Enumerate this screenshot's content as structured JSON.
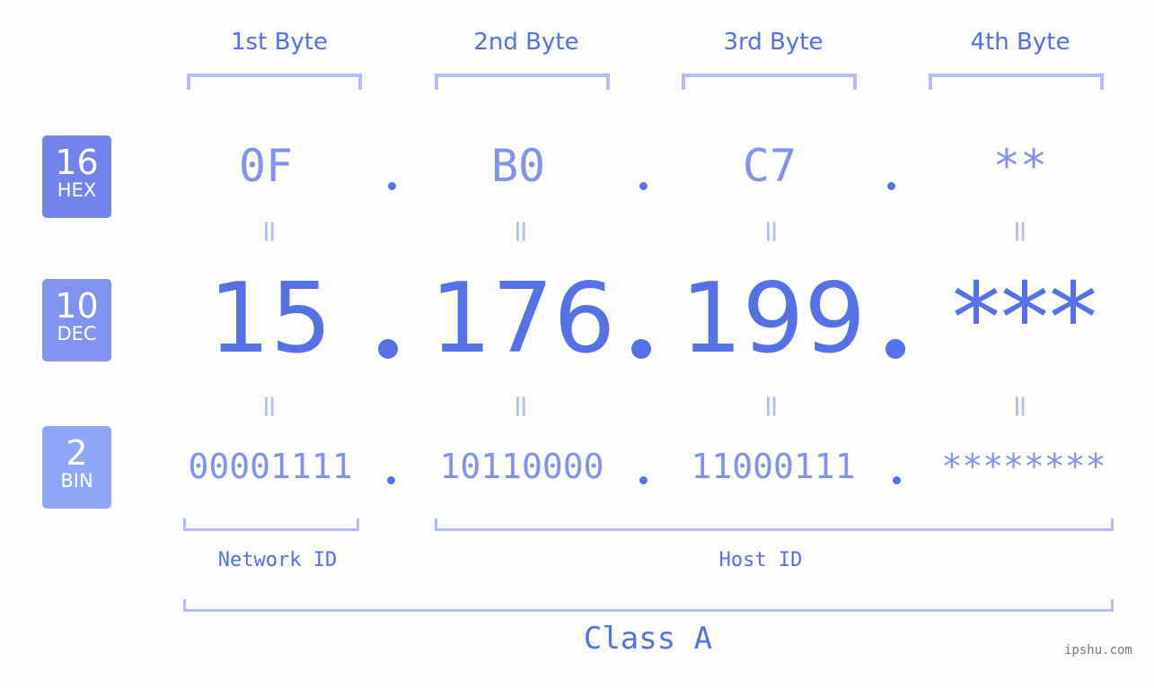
{
  "bytes": {
    "labels": [
      "1st Byte",
      "2nd Byte",
      "3rd Byte",
      "4th Byte"
    ],
    "hex": [
      "0F",
      "B0",
      "C7",
      "**"
    ],
    "dec": [
      "15",
      "176",
      "199",
      "***"
    ],
    "bin": [
      "00001111",
      "10110000",
      "11000111",
      "********"
    ],
    "separator": "=",
    "dot": "."
  },
  "badges": [
    {
      "number": "16",
      "label": "HEX",
      "color": "#7383eb"
    },
    {
      "number": "10",
      "label": "DEC",
      "color": "#8292f0"
    },
    {
      "number": "2",
      "label": "BIN",
      "color": "#8fa6f8"
    }
  ],
  "segments": {
    "network": "Network ID",
    "host": "Host ID",
    "class": "Class A"
  },
  "colors": {
    "accent": "#5670e8",
    "light": "#8291ee",
    "bracket": "#b3bcf6",
    "background": "#fbfcfb"
  },
  "brand": "ipshu.com"
}
